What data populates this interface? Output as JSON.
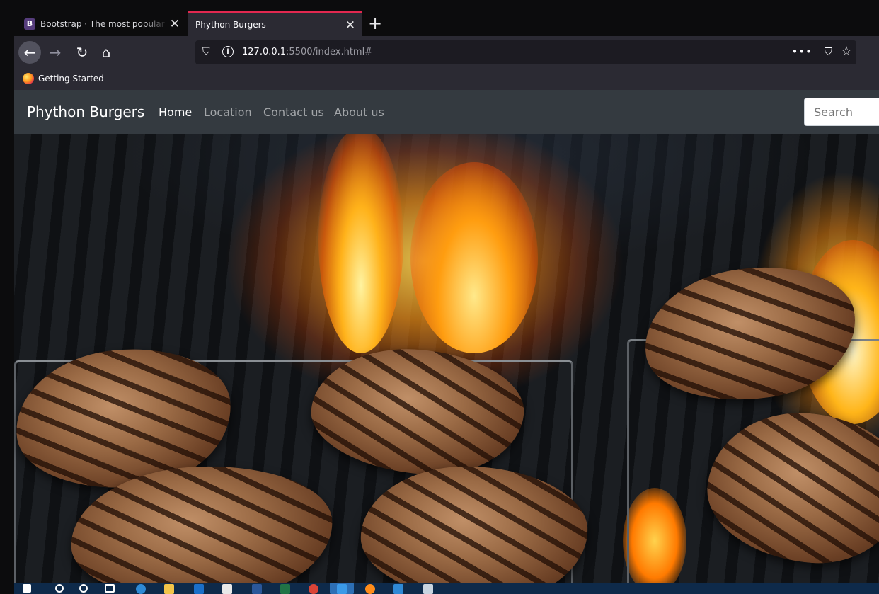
{
  "browser": {
    "tabs": [
      {
        "label": "Bootstrap · The most popular HTML, CSS, and JS library in the world",
        "favicon": "B",
        "active": false
      },
      {
        "label": "Phython Burgers",
        "active": true
      }
    ],
    "url_host": "127.0.0.1",
    "url_rest": ":5500/index.html#",
    "bookmarks": [
      {
        "label": "Getting Started"
      }
    ]
  },
  "site": {
    "brand": "Phython Burgers",
    "nav": [
      {
        "label": "Home",
        "active": true
      },
      {
        "label": "Location"
      },
      {
        "label": "Contact us"
      },
      {
        "label": "About us"
      }
    ],
    "search_placeholder": "Search"
  },
  "colors": {
    "navbar": "#343a40",
    "tab_accent": "#e22850",
    "chrome": "#2b2a33",
    "taskbar": "#0e2a4a"
  }
}
